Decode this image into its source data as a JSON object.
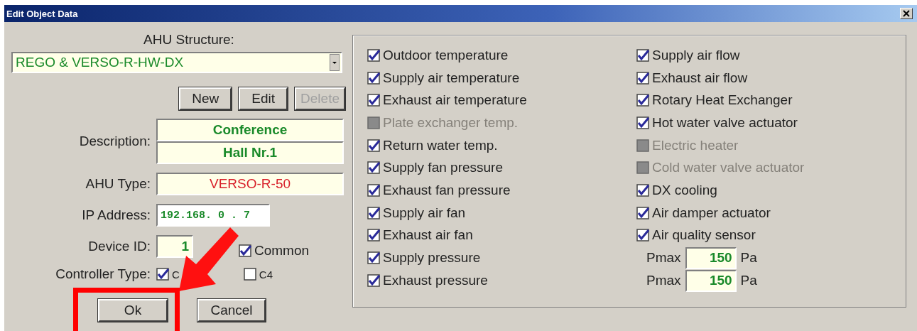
{
  "window": {
    "title": "Edit Object Data"
  },
  "ahu_structure": {
    "label": "AHU Structure:",
    "value": "REGO & VERSO-R-HW-DX"
  },
  "structure_buttons": [
    {
      "label": "New",
      "disabled": false
    },
    {
      "label": "Edit",
      "disabled": false
    },
    {
      "label": "Delete",
      "disabled": true
    }
  ],
  "description": {
    "label": "Description:",
    "lines": [
      "Conference",
      "Hall Nr.1"
    ]
  },
  "ahu_type": {
    "label": "AHU Type:",
    "value": "VERSO-R-50"
  },
  "ip_address": {
    "label": "IP Address:",
    "value": "192.168. 0 . 7"
  },
  "device_id": {
    "label": "Device ID:",
    "value": "1"
  },
  "common": {
    "label": "Common",
    "checked": true
  },
  "controller_type": {
    "label": "Controller Type:",
    "options": [
      {
        "label": "C",
        "checked": true
      },
      {
        "label": "C4",
        "checked": false
      }
    ]
  },
  "actions": [
    {
      "label": "Ok"
    },
    {
      "label": "Cancel"
    }
  ],
  "features": [
    [
      {
        "label": "Outdoor temperature",
        "checked": true,
        "disabled": false
      },
      {
        "label": "Supply air temperature",
        "checked": true,
        "disabled": false
      },
      {
        "label": "Exhaust air temperature",
        "checked": true,
        "disabled": false
      },
      {
        "label": "Plate exchanger temp.",
        "checked": false,
        "disabled": true
      },
      {
        "label": "Return water temp.",
        "checked": true,
        "disabled": false
      },
      {
        "label": "Supply fan pressure",
        "checked": true,
        "disabled": false
      },
      {
        "label": "Exhaust fan pressure",
        "checked": true,
        "disabled": false
      },
      {
        "label": "Supply air fan",
        "checked": true,
        "disabled": false
      },
      {
        "label": "Exhaust air fan",
        "checked": true,
        "disabled": false
      },
      {
        "label": "Supply pressure",
        "checked": true,
        "disabled": false
      },
      {
        "label": "Exhaust pressure",
        "checked": true,
        "disabled": false
      }
    ],
    [
      {
        "label": "Supply air flow",
        "checked": true,
        "disabled": false
      },
      {
        "label": "Exhaust air flow",
        "checked": true,
        "disabled": false
      },
      {
        "label": "Rotary Heat Exchanger",
        "checked": true,
        "disabled": false
      },
      {
        "label": "Hot water valve actuator",
        "checked": true,
        "disabled": false
      },
      {
        "label": "Electric heater",
        "checked": false,
        "disabled": true
      },
      {
        "label": "Cold water valve actuator",
        "checked": false,
        "disabled": true
      },
      {
        "label": "DX cooling",
        "checked": true,
        "disabled": false
      },
      {
        "label": "Air damper actuator",
        "checked": true,
        "disabled": false
      },
      {
        "label": "Air quality sensor",
        "checked": true,
        "disabled": false
      }
    ]
  ],
  "pressure_limits": [
    {
      "label": "Pmax",
      "value": "150",
      "unit": "Pa"
    },
    {
      "label": "Pmax",
      "value": "150",
      "unit": "Pa"
    }
  ],
  "annotations": {
    "pointer_arrow": true,
    "highlight_frame": true
  }
}
